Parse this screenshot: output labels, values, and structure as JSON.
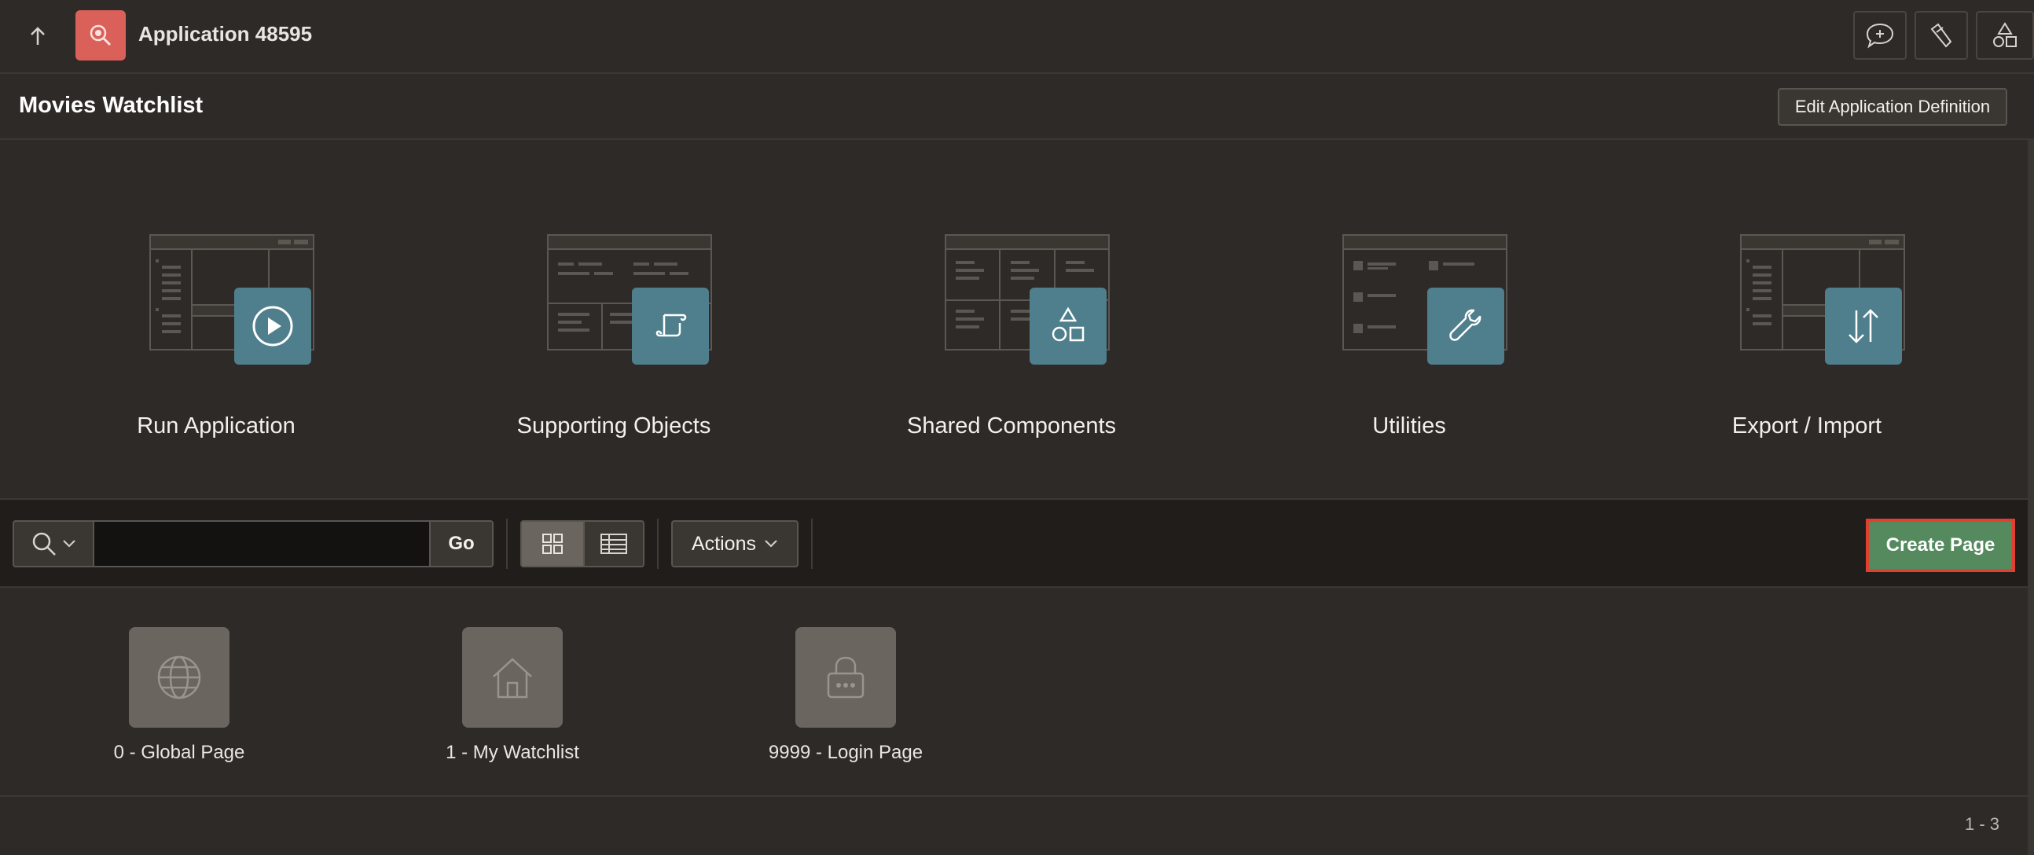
{
  "topbar": {
    "app_title": "Application 48595",
    "app_icon": "app-badge-icon",
    "buttons": [
      "feedback-icon",
      "flashlight-icon",
      "shapes-icon"
    ]
  },
  "header": {
    "page_title": "Movies Watchlist",
    "edit_definition_label": "Edit Application Definition"
  },
  "tiles": [
    {
      "label": "Run Application",
      "icon": "play-icon"
    },
    {
      "label": "Supporting Objects",
      "icon": "scroll-icon"
    },
    {
      "label": "Shared Components",
      "icon": "shapes-icon"
    },
    {
      "label": "Utilities",
      "icon": "wrench-icon"
    },
    {
      "label": "Export / Import",
      "icon": "arrows-updown-icon"
    }
  ],
  "toolbar": {
    "search_value": "",
    "go_label": "Go",
    "actions_label": "Actions",
    "create_page_label": "Create Page"
  },
  "pages": [
    {
      "label": "0 - Global Page",
      "icon": "globe-icon"
    },
    {
      "label": "1 - My Watchlist",
      "icon": "home-icon"
    },
    {
      "label": "9999 - Login Page",
      "icon": "lock-icon"
    }
  ],
  "pagination": "1 - 3",
  "colors": {
    "background": "#2e2a27",
    "tile_badge": "#4f7f8c",
    "create_page": "#558a5f",
    "highlight": "#e0402f",
    "app_icon": "#d9615a"
  }
}
